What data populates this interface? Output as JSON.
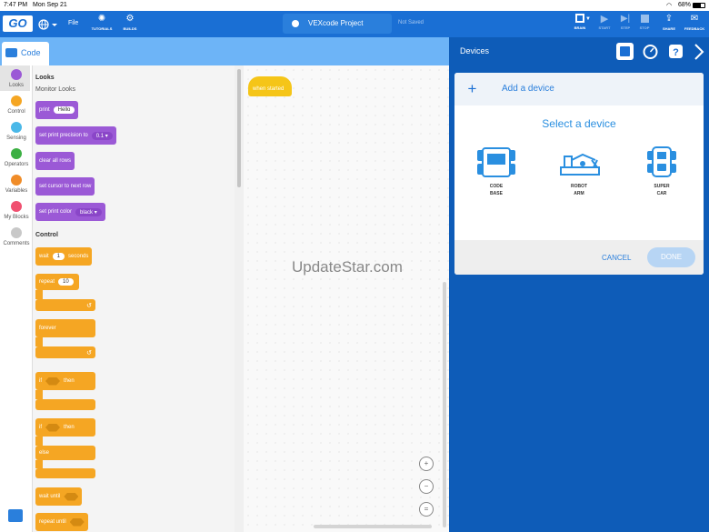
{
  "status": {
    "time": "7:47 PM",
    "date": "Mon Sep 21",
    "battery": "68%"
  },
  "toolbar": {
    "logo": "GO",
    "file": "File",
    "tutorials": "TUTORIALS",
    "builds": "BUILDS",
    "project_name": "VEXcode Project",
    "save_state": "Not Saved",
    "brain": "BRAIN",
    "start": "START",
    "step": "STEP",
    "stop": "STOP",
    "share": "SHARE",
    "feedback": "FEEDBACK"
  },
  "code_tab": "Code",
  "categories": [
    {
      "label": "Looks",
      "color": "#9b59d6"
    },
    {
      "label": "Control",
      "color": "#f5a623"
    },
    {
      "label": "Sensing",
      "color": "#4ab8e8"
    },
    {
      "label": "Operators",
      "color": "#3cb043"
    },
    {
      "label": "Variables",
      "color": "#f08c28"
    },
    {
      "label": "My Blocks",
      "color": "#f05070"
    },
    {
      "label": "Comments",
      "color": "#c8c8c8"
    }
  ],
  "palette": {
    "looks_heading": "Looks",
    "monitor_heading": "Monitor Looks",
    "print": "print",
    "print_value": "Hello",
    "set_precision": "set print precision to",
    "precision_value": "0.1",
    "clear_rows": "clear all rows",
    "set_cursor": "set cursor to next row",
    "set_color": "set print color",
    "color_value": "black",
    "control_heading": "Control",
    "wait": "wait",
    "wait_value": "1",
    "seconds": "seconds",
    "repeat": "repeat",
    "repeat_value": "10",
    "forever": "forever",
    "if": "if",
    "then": "then",
    "if2": "if",
    "then2": "then",
    "else": "else",
    "wait_until": "wait until",
    "repeat_until": "repeat until"
  },
  "workspace": {
    "when_started": "when started",
    "watermark": "UpdateStar.com"
  },
  "devices": {
    "title": "Devices",
    "add_device": "Add a device",
    "select_device": "Select a device",
    "items": [
      {
        "line1": "CODE",
        "line2": "BASE"
      },
      {
        "line1": "ROBOT",
        "line2": "ARM"
      },
      {
        "line1": "SUPER",
        "line2": "CAR"
      }
    ],
    "cancel": "CANCEL",
    "done": "DONE"
  }
}
